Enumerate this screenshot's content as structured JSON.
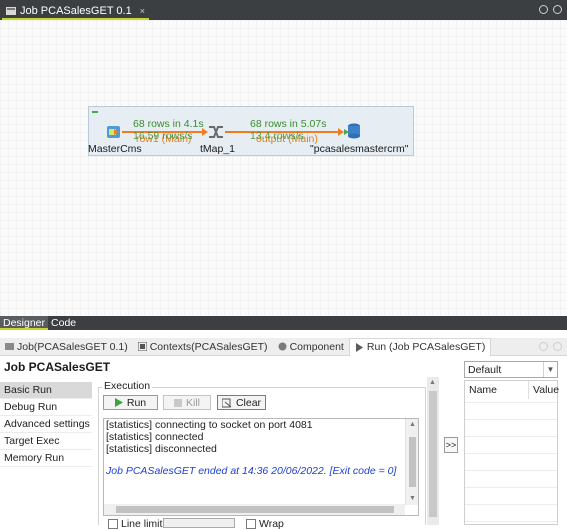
{
  "editor": {
    "tab_title": "Job PCASalesGET 0.1",
    "close_glyph": "×"
  },
  "job_flow": {
    "components": [
      {
        "label": "MasterCms",
        "icon": "input-component-icon"
      },
      {
        "label": "tMap_1",
        "icon": "tmap-icon"
      },
      {
        "label": "\"pcasalesmastercrm\"",
        "icon": "database-output-icon"
      }
    ],
    "links": [
      {
        "stat": "68 rows in 4.1s",
        "rate": "16.59 rows/s",
        "name": "row1 (Main)"
      },
      {
        "stat": "68 rows in 5.07s",
        "rate": "13.4 rows/s",
        "name": "output (Main)"
      }
    ]
  },
  "designer_tabs": [
    "Designer",
    "Code"
  ],
  "bottom_tabs": [
    {
      "label": "Job(PCASalesGET 0.1)",
      "icon": "job-icon"
    },
    {
      "label": "Contexts(PCASalesGET)",
      "icon": "contexts-icon"
    },
    {
      "label": "Component",
      "icon": "component-icon"
    },
    {
      "label": "Run (Job PCASalesGET)",
      "icon": "run-icon"
    }
  ],
  "run_panel": {
    "title": "Job PCASalesGET",
    "nav_items": [
      "Basic Run",
      "Debug Run",
      "Advanced settings",
      "Target Exec",
      "Memory Run"
    ],
    "execution_label": "Execution",
    "buttons": {
      "run": "Run",
      "kill": "Kill",
      "clear": "Clear"
    },
    "console_lines": [
      "[statistics] connecting to socket on port 4081",
      "[statistics] connected",
      "[statistics] disconnected"
    ],
    "console_final": "Job PCASalesGET ended at 14:36 20/06/2022. [Exit code  = 0]",
    "toggle_label": ">>",
    "line_limit_label": "Line limit",
    "wrap_label": "Wrap"
  },
  "context_panel": {
    "selected": "Default",
    "columns": [
      "Name",
      "Value"
    ]
  },
  "colors": {
    "accent": "#c6d62f",
    "flow": "#f07c22",
    "stat_green": "#3c8c2e",
    "exit_blue": "#1f3fd1"
  }
}
